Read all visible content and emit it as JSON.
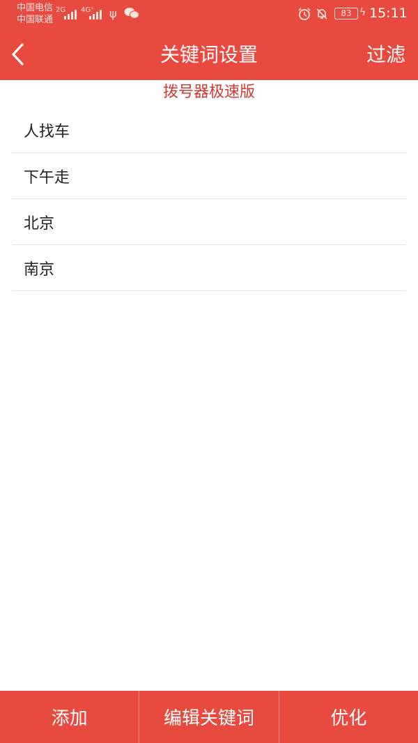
{
  "status_bar": {
    "carrier_1": "中国电信",
    "carrier_2": "中国联通",
    "network_1": "2G",
    "network_2": "4G⁺",
    "icons": [
      "usb-icon",
      "wechat-icon",
      "alarm-icon",
      "mute-bell-icon",
      "battery-icon",
      "charging-icon"
    ],
    "battery": "83",
    "time": "15:11"
  },
  "header": {
    "back_icon": "chevron-left-icon",
    "title": "关键词设置",
    "filter_label": "过滤"
  },
  "subtitle": "拨号器极速版",
  "keywords": [
    "人找车",
    "下午走",
    "北京",
    "南京"
  ],
  "bottom_bar": {
    "add_label": "添加",
    "edit_label": "编辑关键词",
    "optimize_label": "优化"
  },
  "colors": {
    "brand_red": "#e84a3f",
    "subtitle_red": "#d03a30",
    "divider": "#e2e2e2"
  }
}
